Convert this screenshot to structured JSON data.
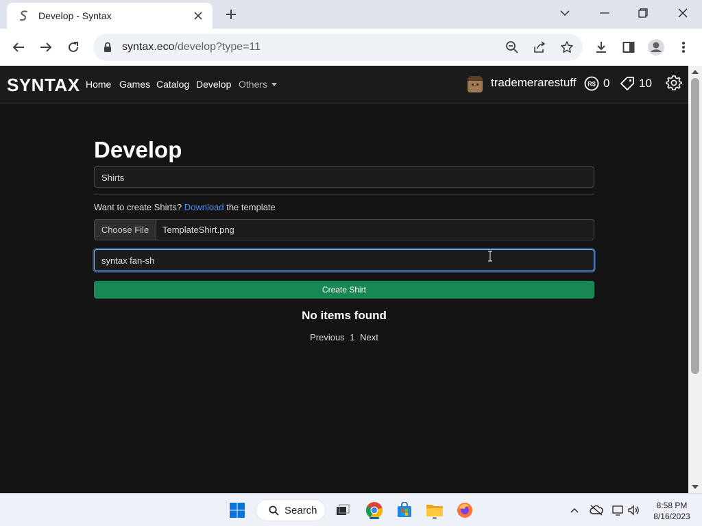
{
  "browser": {
    "tab_title": "Develop - Syntax",
    "url_host": "syntax.eco",
    "url_path": "/develop?type=11"
  },
  "site": {
    "brand": "SYNTAX",
    "nav": [
      "Home",
      "Games",
      "Catalog",
      "Develop"
    ],
    "nav_dropdown": "Others",
    "username": "trademerarestuff",
    "robux": "0",
    "tickets": "10"
  },
  "develop": {
    "title": "Develop",
    "asset_type": "Shirts",
    "hint_prefix": "Want to create Shirts?",
    "hint_link": "Download",
    "hint_suffix": "the template",
    "file_button": "Choose File",
    "file_name": "TemplateShirt.png",
    "name_value": "syntax fan-sh",
    "create_button": "Create Shirt",
    "empty_text": "No items found",
    "pager_prev": "Previous",
    "pager_page": "1",
    "pager_next": "Next"
  },
  "taskbar": {
    "search_label": "Search",
    "time": "8:58 PM",
    "date": "8/16/2023"
  },
  "colors": {
    "page_bg": "#141414",
    "navbar_bg": "#1b1b1b",
    "create_button": "#198754",
    "link": "#4d8df5",
    "focus_ring": "#8ab4f8"
  }
}
